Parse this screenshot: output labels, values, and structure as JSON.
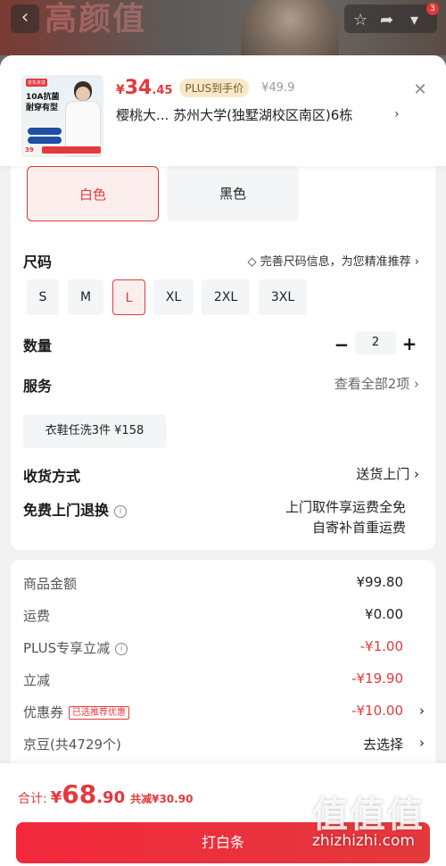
{
  "header": {
    "back_icon": "chevron-left-icon",
    "bg_text": "高颜值",
    "icons": [
      "star-icon",
      "share-icon",
      "cart-icon"
    ],
    "cart_count": "3"
  },
  "product": {
    "thumb_brand": "京东京造",
    "thumb_title": "10A抗菌耐穿有型",
    "thumb_price": "39",
    "currency": "¥",
    "price_int": "34",
    "price_dec": ".45",
    "plus_tag": "PLUS到手价",
    "old_price": "¥49.9",
    "address": "樱桃大...  苏州大学(独墅湖校区南区)6栋",
    "address_arrow": "›",
    "close": "✕"
  },
  "colors": {
    "options": [
      "白色",
      "黑色"
    ],
    "selected": "白色"
  },
  "size": {
    "label": "尺码",
    "hint": "完善尺码信息，为您精准推荐 ›",
    "options": [
      "S",
      "M",
      "L",
      "XL",
      "2XL",
      "3XL"
    ],
    "selected": "L"
  },
  "quantity": {
    "label": "数量",
    "minus": "−",
    "value": "2",
    "plus": "+"
  },
  "service": {
    "label": "服务",
    "link": "查看全部2项 ›",
    "chip": "衣鞋任洗3件  ¥158"
  },
  "delivery": {
    "label": "收货方式",
    "value": "送货上门 ›"
  },
  "returns": {
    "label": "免费上门退换",
    "line1": "上门取件享运费全免",
    "line2": "自寄补首重运费"
  },
  "fees": {
    "goods_label": "商品金额",
    "goods_value": "¥99.80",
    "shipping_label": "运费",
    "shipping_value": "¥0.00",
    "plus_label": "PLUS专享立减",
    "plus_value": "-¥1.00",
    "discount_label": "立减",
    "discount_value": "-¥19.90",
    "coupon_label": "优惠券",
    "coupon_tag": "已选推荐优惠",
    "coupon_value": "-¥10.00",
    "jingdou_label": "京豆(共4729个)",
    "jingdou_value": "去选择"
  },
  "footer": {
    "total_label": "合计:",
    "total_currency": "¥",
    "total_int": "68",
    "total_dec": ".90",
    "total_saved": "共减¥30.90",
    "pay_button": "打白条"
  },
  "watermark": {
    "glyphs": "值值值",
    "url": "zhizhizhi.com"
  },
  "colors_theme": {
    "accent": "#e4393c",
    "plus_bg": "#f7e8c9"
  }
}
